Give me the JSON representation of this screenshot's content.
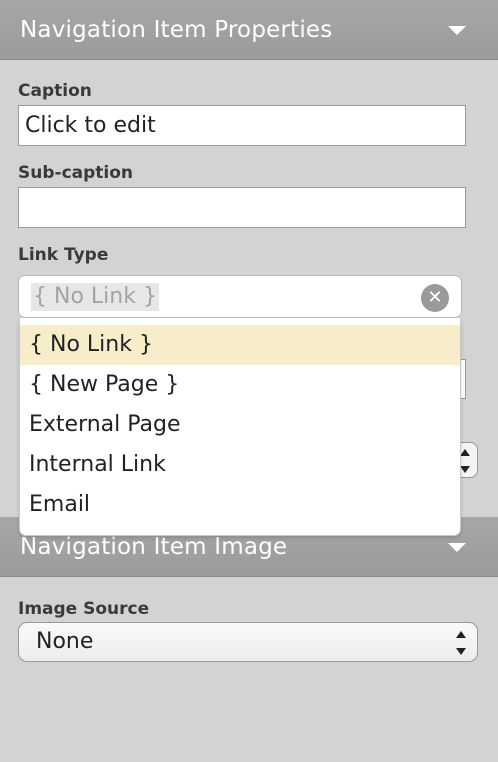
{
  "properties_panel": {
    "title": "Navigation Item Properties",
    "toggle_icon": "chevron-down-icon"
  },
  "caption": {
    "label": "Caption",
    "value": "Click to edit"
  },
  "subcaption": {
    "label": "Sub-caption",
    "value": ""
  },
  "link_type": {
    "label": "Link Type",
    "placeholder": "{ No Link }",
    "clear_icon": "clear-circle-x-icon",
    "options": [
      "{ No Link }",
      "{ New Page }",
      "External Page",
      "Internal Link",
      "Email"
    ],
    "highlighted_option": "{ No Link }"
  },
  "image_panel": {
    "title": "Navigation Item Image",
    "toggle_icon": "chevron-down-icon"
  },
  "image_source": {
    "label": "Image Source",
    "value": "None",
    "arrows_icon": "up-down-arrows-icon"
  },
  "colors": {
    "background": "#d3d3d3",
    "header": "#a1a1a1",
    "highlight": "#f8edcb"
  }
}
